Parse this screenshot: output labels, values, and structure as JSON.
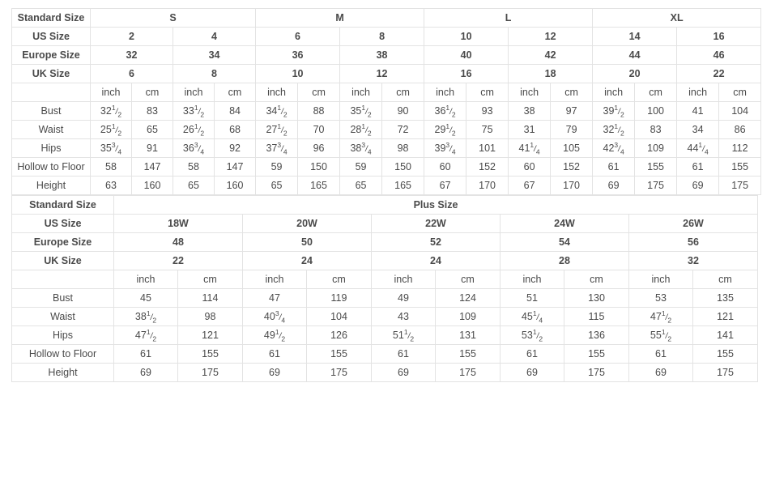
{
  "standard_table": {
    "corner_label": "Standard Size",
    "group_headers": [
      "S",
      "M",
      "L",
      "XL"
    ],
    "rows": [
      {
        "label": "US Size",
        "values": [
          "2",
          "4",
          "6",
          "8",
          "10",
          "12",
          "14",
          "16"
        ]
      },
      {
        "label": "Europe Size",
        "values": [
          "32",
          "34",
          "36",
          "38",
          "40",
          "42",
          "44",
          "46"
        ]
      },
      {
        "label": "UK Size",
        "values": [
          "6",
          "8",
          "10",
          "12",
          "16",
          "18",
          "20",
          "22"
        ]
      }
    ],
    "unit_row": {
      "label": "",
      "units": [
        "inch",
        "cm",
        "inch",
        "cm",
        "inch",
        "cm",
        "inch",
        "cm",
        "inch",
        "cm",
        "inch",
        "cm",
        "inch",
        "cm",
        "inch",
        "cm"
      ]
    },
    "measure_rows": [
      {
        "label": "Bust",
        "values": [
          {
            "whole": "32",
            "num": "1",
            "den": "2"
          },
          {
            "whole": "83"
          },
          {
            "whole": "33",
            "num": "1",
            "den": "2"
          },
          {
            "whole": "84"
          },
          {
            "whole": "34",
            "num": "1",
            "den": "2"
          },
          {
            "whole": "88"
          },
          {
            "whole": "35",
            "num": "1",
            "den": "2"
          },
          {
            "whole": "90"
          },
          {
            "whole": "36",
            "num": "1",
            "den": "2"
          },
          {
            "whole": "93"
          },
          {
            "whole": "38"
          },
          {
            "whole": "97"
          },
          {
            "whole": "39",
            "num": "1",
            "den": "2"
          },
          {
            "whole": "100"
          },
          {
            "whole": "41"
          },
          {
            "whole": "104"
          }
        ]
      },
      {
        "label": "Waist",
        "values": [
          {
            "whole": "25",
            "num": "1",
            "den": "2"
          },
          {
            "whole": "65"
          },
          {
            "whole": "26",
            "num": "1",
            "den": "2"
          },
          {
            "whole": "68"
          },
          {
            "whole": "27",
            "num": "1",
            "den": "2"
          },
          {
            "whole": "70"
          },
          {
            "whole": "28",
            "num": "1",
            "den": "2"
          },
          {
            "whole": "72"
          },
          {
            "whole": "29",
            "num": "1",
            "den": "2"
          },
          {
            "whole": "75"
          },
          {
            "whole": "31"
          },
          {
            "whole": "79"
          },
          {
            "whole": "32",
            "num": "1",
            "den": "2"
          },
          {
            "whole": "83"
          },
          {
            "whole": "34"
          },
          {
            "whole": "86"
          }
        ]
      },
      {
        "label": "Hips",
        "values": [
          {
            "whole": "35",
            "num": "3",
            "den": "4"
          },
          {
            "whole": "91"
          },
          {
            "whole": "36",
            "num": "3",
            "den": "4"
          },
          {
            "whole": "92"
          },
          {
            "whole": "37",
            "num": "3",
            "den": "4"
          },
          {
            "whole": "96"
          },
          {
            "whole": "38",
            "num": "3",
            "den": "4"
          },
          {
            "whole": "98"
          },
          {
            "whole": "39",
            "num": "3",
            "den": "4"
          },
          {
            "whole": "101"
          },
          {
            "whole": "41",
            "num": "1",
            "den": "4"
          },
          {
            "whole": "105"
          },
          {
            "whole": "42",
            "num": "3",
            "den": "4"
          },
          {
            "whole": "109"
          },
          {
            "whole": "44",
            "num": "1",
            "den": "4"
          },
          {
            "whole": "112"
          }
        ]
      },
      {
        "label": "Hollow to Floor",
        "tall": true,
        "values": [
          {
            "whole": "58"
          },
          {
            "whole": "147"
          },
          {
            "whole": "58"
          },
          {
            "whole": "147"
          },
          {
            "whole": "59"
          },
          {
            "whole": "150"
          },
          {
            "whole": "59"
          },
          {
            "whole": "150"
          },
          {
            "whole": "60"
          },
          {
            "whole": "152"
          },
          {
            "whole": "60"
          },
          {
            "whole": "152"
          },
          {
            "whole": "61"
          },
          {
            "whole": "155"
          },
          {
            "whole": "61"
          },
          {
            "whole": "155"
          }
        ]
      },
      {
        "label": "Height",
        "values": [
          {
            "whole": "63"
          },
          {
            "whole": "160"
          },
          {
            "whole": "65"
          },
          {
            "whole": "160"
          },
          {
            "whole": "65"
          },
          {
            "whole": "165"
          },
          {
            "whole": "65"
          },
          {
            "whole": "165"
          },
          {
            "whole": "67"
          },
          {
            "whole": "170"
          },
          {
            "whole": "67"
          },
          {
            "whole": "170"
          },
          {
            "whole": "69"
          },
          {
            "whole": "175"
          },
          {
            "whole": "69"
          },
          {
            "whole": "175"
          }
        ]
      }
    ]
  },
  "plus_table": {
    "corner_label": "Standard Size",
    "group_title": "Plus Size",
    "rows": [
      {
        "label": "US Size",
        "values": [
          "18W",
          "20W",
          "22W",
          "24W",
          "26W"
        ]
      },
      {
        "label": "Europe Size",
        "values": [
          "48",
          "50",
          "52",
          "54",
          "56"
        ]
      },
      {
        "label": "UK Size",
        "values": [
          "22",
          "24",
          "24",
          "28",
          "32"
        ]
      }
    ],
    "unit_row": {
      "label": "",
      "units": [
        "inch",
        "cm",
        "inch",
        "cm",
        "inch",
        "cm",
        "inch",
        "cm",
        "inch",
        "cm"
      ]
    },
    "measure_rows": [
      {
        "label": "Bust",
        "values": [
          {
            "whole": "45"
          },
          {
            "whole": "114"
          },
          {
            "whole": "47"
          },
          {
            "whole": "119"
          },
          {
            "whole": "49"
          },
          {
            "whole": "124"
          },
          {
            "whole": "51"
          },
          {
            "whole": "130"
          },
          {
            "whole": "53"
          },
          {
            "whole": "135"
          }
        ]
      },
      {
        "label": "Waist",
        "values": [
          {
            "whole": "38",
            "num": "1",
            "den": "2"
          },
          {
            "whole": "98"
          },
          {
            "whole": "40",
            "num": "3",
            "den": "4"
          },
          {
            "whole": "104"
          },
          {
            "whole": "43"
          },
          {
            "whole": "109"
          },
          {
            "whole": "45",
            "num": "1",
            "den": "4"
          },
          {
            "whole": "115"
          },
          {
            "whole": "47",
            "num": "1",
            "den": "2"
          },
          {
            "whole": "121"
          }
        ]
      },
      {
        "label": "Hips",
        "values": [
          {
            "whole": "47",
            "num": "1",
            "den": "2"
          },
          {
            "whole": "121"
          },
          {
            "whole": "49",
            "num": "1",
            "den": "2"
          },
          {
            "whole": "126"
          },
          {
            "whole": "51",
            "num": "1",
            "den": "2"
          },
          {
            "whole": "131"
          },
          {
            "whole": "53",
            "num": "1",
            "den": "2"
          },
          {
            "whole": "136"
          },
          {
            "whole": "55",
            "num": "1",
            "den": "2"
          },
          {
            "whole": "141"
          }
        ]
      },
      {
        "label": "Hollow to Floor",
        "tall": true,
        "values": [
          {
            "whole": "61"
          },
          {
            "whole": "155"
          },
          {
            "whole": "61"
          },
          {
            "whole": "155"
          },
          {
            "whole": "61"
          },
          {
            "whole": "155"
          },
          {
            "whole": "61"
          },
          {
            "whole": "155"
          },
          {
            "whole": "61"
          },
          {
            "whole": "155"
          }
        ]
      },
      {
        "label": "Height",
        "values": [
          {
            "whole": "69"
          },
          {
            "whole": "175"
          },
          {
            "whole": "69"
          },
          {
            "whole": "175"
          },
          {
            "whole": "69"
          },
          {
            "whole": "175"
          },
          {
            "whole": "69"
          },
          {
            "whole": "175"
          },
          {
            "whole": "69"
          },
          {
            "whole": "175"
          }
        ]
      }
    ]
  },
  "colors": {
    "header_bg": "#ebebeb",
    "border": "#e3e3e3",
    "text_dark": "#1c1c1c",
    "text_value": "#5a5a5a",
    "unit_text": "#9a9a9a"
  }
}
